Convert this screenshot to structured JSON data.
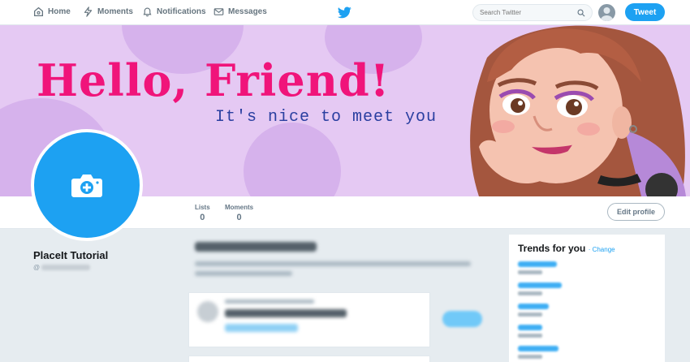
{
  "nav": {
    "home": "Home",
    "moments": "Moments",
    "notifications": "Notifications",
    "messages": "Messages",
    "search_placeholder": "Search Twitter",
    "tweet_button": "Tweet"
  },
  "banner": {
    "title": "Hello, Friend!",
    "subtitle": "It's nice to meet you"
  },
  "stats": {
    "lists_label": "Lists",
    "lists_value": "0",
    "moments_label": "Moments",
    "moments_value": "0"
  },
  "profile": {
    "name": "PlaceIt Tutorial",
    "handle_prefix": "@",
    "edit_button": "Edit profile"
  },
  "trends": {
    "title": "Trends for you",
    "change_link": "· Change"
  },
  "colors": {
    "accent": "#1da1f2",
    "banner_bg": "#e5c9f3",
    "banner_title": "#f0147a",
    "banner_subtitle": "#2a3fa0"
  }
}
